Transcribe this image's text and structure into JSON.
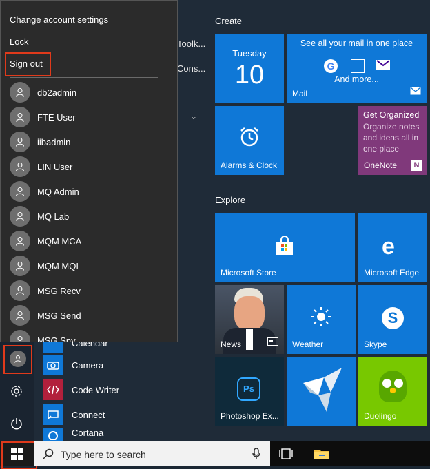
{
  "app_list_peek": [
    "Toolk...",
    "Cons..."
  ],
  "app_list": [
    {
      "label": "Calendar",
      "icon": "calendar-icon"
    },
    {
      "label": "Camera",
      "icon": "camera-icon"
    },
    {
      "label": "Code Writer",
      "icon": "code-writer-icon"
    },
    {
      "label": "Connect",
      "icon": "connect-icon"
    },
    {
      "label": "Cortana",
      "icon": "cortana-icon"
    }
  ],
  "account_menu": {
    "change_settings": "Change account settings",
    "lock": "Lock",
    "sign_out": "Sign out",
    "users": [
      "db2admin",
      "FTE User",
      "iibadmin",
      "LIN User",
      "MQ Admin",
      "MQ Lab",
      "MQM MCA",
      "MQM MQI",
      "MSG Recv",
      "MSG Send",
      "MSG Sny"
    ]
  },
  "sections": {
    "create": "Create",
    "explore": "Explore"
  },
  "tiles": {
    "calendar_day": "Tuesday",
    "calendar_date": "10",
    "mail_title": "See all your mail in one place",
    "mail_more": "And more...",
    "mail_label": "Mail",
    "onenote_heading": "Get Organized",
    "onenote_body": "Organize notes and ideas all in one place",
    "onenote_label": "OneNote",
    "alarms_label": "Alarms & Clock",
    "store_label": "Microsoft Store",
    "edge_label": "Microsoft Edge",
    "news_label": "News",
    "weather_label": "Weather",
    "skype_label": "Skype",
    "photoshop_label": "Photoshop Ex...",
    "duolingo_label": "Duolingo"
  },
  "taskbar": {
    "search_placeholder": "Type here to search"
  },
  "colors": {
    "tile_blue": "#0f78d7",
    "onenote_purple": "#80397b",
    "duolingo_green": "#78c800",
    "highlight_red": "#e03a1b"
  }
}
